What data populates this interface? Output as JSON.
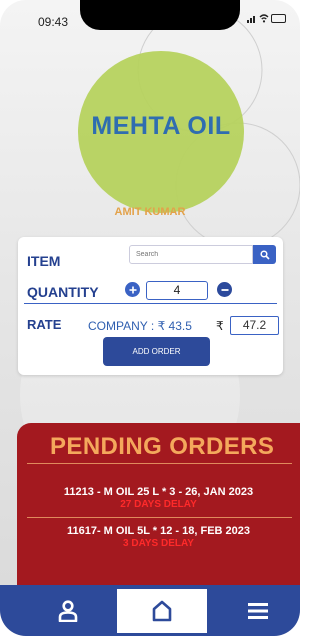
{
  "status_bar": {
    "time": "09:43"
  },
  "logo": {
    "brand": "MEHTA OIL",
    "owner": "AMIT KUMAR"
  },
  "form": {
    "item_label": "ITEM",
    "search_placeholder": "Search",
    "quantity_label": "QUANTITY",
    "quantity_value": "4",
    "rate_label": "RATE",
    "company_rate": "COMPANY : ₹ 43.5",
    "currency_symbol": "₹",
    "rate_value": "47.2",
    "add_order_label": "ADD ORDER"
  },
  "pending": {
    "title": "PENDING ORDERS",
    "orders": [
      {
        "summary": "11213 - M OIL 25 L * 3  -  26, JAN 2023",
        "delay": "27 DAYS DELAY"
      },
      {
        "summary": "11617- M OIL 5L * 12  -  18, FEB 2023",
        "delay": "3 DAYS DELAY"
      }
    ]
  },
  "nav": {
    "items": [
      {
        "icon": "user-icon"
      },
      {
        "icon": "home-icon",
        "active": true
      },
      {
        "icon": "menu-icon"
      }
    ]
  },
  "colors": {
    "accent_blue": "#2d4a9a",
    "pending_red": "#a3191f",
    "pending_title": "#f4a85c",
    "logo_green": "#b6d25e"
  }
}
